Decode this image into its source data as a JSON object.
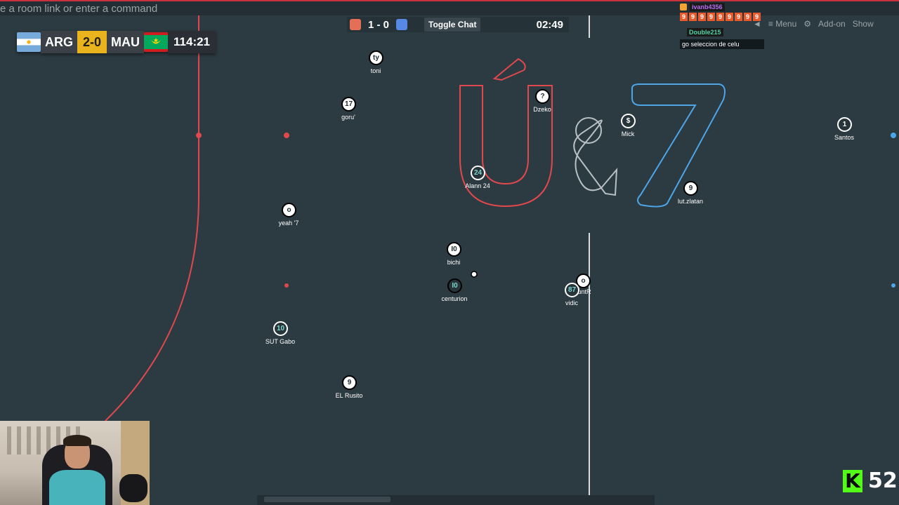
{
  "command_bar": {
    "placeholder": "e a room link or enter a command"
  },
  "scoreboard": {
    "home_team": "ARG",
    "away_team": "MAU",
    "score": "2-0",
    "time": "114:21"
  },
  "game_bar": {
    "score": "1 - 0",
    "toggle_chat_label": "Toggle Chat",
    "clock": "02:49",
    "red_color": "#e56e56",
    "blue_color": "#5689e5"
  },
  "menu": {
    "items": [
      "Menu",
      "Add-on",
      "Show"
    ]
  },
  "chat": {
    "user1": "ivanb4356",
    "nines": [
      "9",
      "9",
      "9",
      "9",
      "9",
      "9",
      "9",
      "9",
      "9"
    ],
    "user2": "Double215",
    "message": "go seleccion de celu"
  },
  "players": [
    {
      "number": "ty",
      "name": "toni",
      "style": "white"
    },
    {
      "number": "17",
      "name": "goru'",
      "style": "white"
    },
    {
      "number": "?",
      "name": "Dzeko",
      "style": "white"
    },
    {
      "number": "$",
      "name": "Mick",
      "style": "dark"
    },
    {
      "number": "1",
      "name": "Santos",
      "style": "dark"
    },
    {
      "number": "24",
      "name": "Alann 24",
      "style": "dark"
    },
    {
      "number": "9",
      "name": "lut.zlatan",
      "style": "white"
    },
    {
      "number": "o",
      "name": "yeah '7",
      "style": "white"
    },
    {
      "number": "I0",
      "name": "bichi",
      "style": "white"
    },
    {
      "number": "I0",
      "name": "centurion",
      "style": "dark"
    },
    {
      "number": "o",
      "name": "untR",
      "style": "white"
    },
    {
      "number": "87",
      "name": "vidic",
      "style": "dark"
    },
    {
      "number": "10",
      "name": "SUT Gabo",
      "style": "dark"
    },
    {
      "number": "9",
      "name": "EL Rusito",
      "style": "white"
    }
  ],
  "logo": {
    "text_left": "Ú",
    "amp": "&",
    "text_right": "7"
  },
  "stream": {
    "kick_count": "52",
    "kick_letter": "K",
    "kick_color": "#53fc18"
  }
}
